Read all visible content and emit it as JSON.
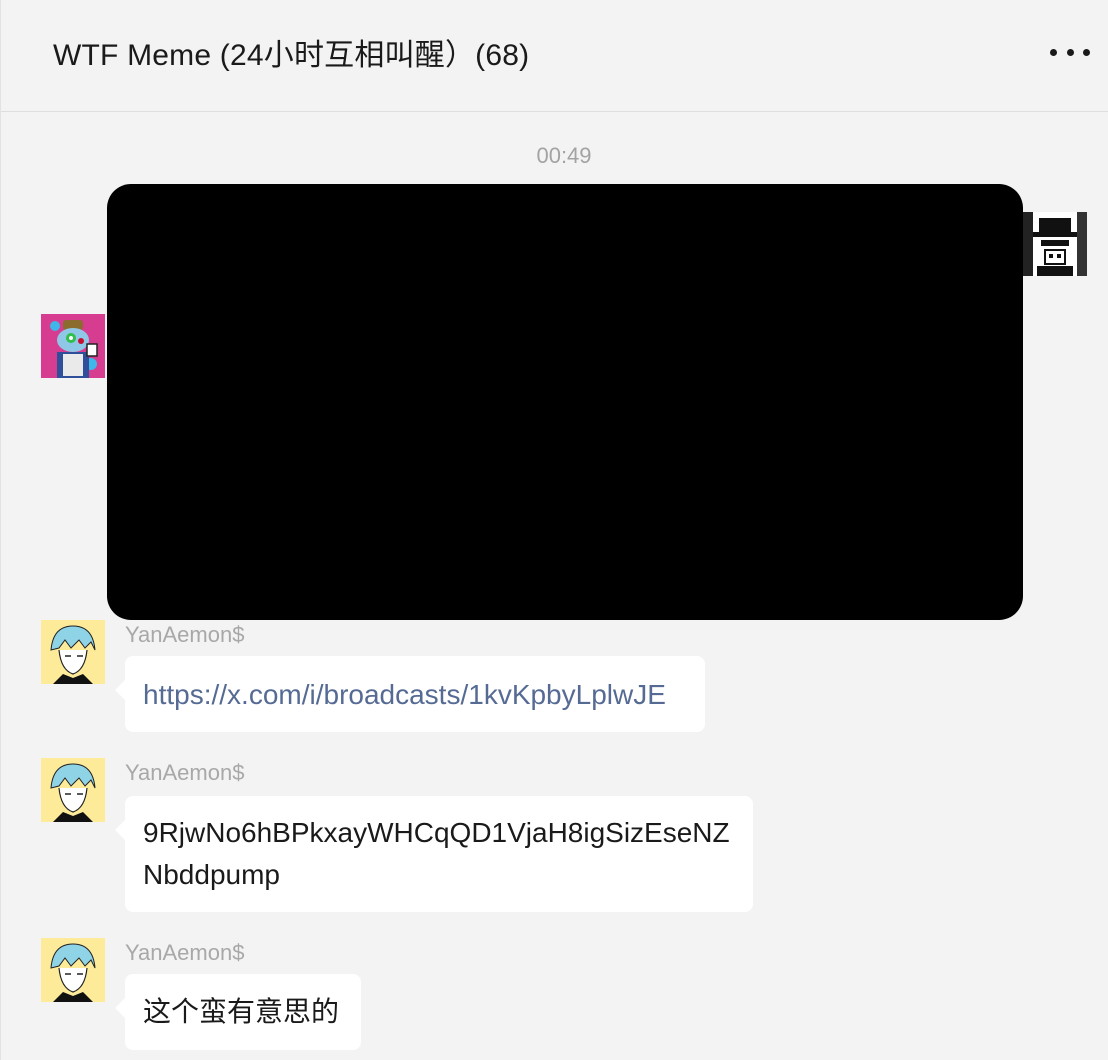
{
  "header": {
    "title": "WTF Meme (24小时互相叫醒）(68)",
    "more_icon": "more-horizontal-icon"
  },
  "chat": {
    "timestamp": "00:49",
    "messages": [
      {
        "sender": "YanAemon$",
        "text": "https://x.com/i/broadcasts/1kvKpbyLplwJE",
        "is_link": true
      },
      {
        "sender": "YanAemon$",
        "line1": "9RjwNo6hBPkxayWHCqQD1VjaH8igSizEseNZ",
        "line2": "Nbddpump"
      },
      {
        "sender": "YanAemon$",
        "text": "这个蛮有意思的"
      }
    ]
  },
  "colors": {
    "background": "#f3f3f3",
    "bubble": "#ffffff",
    "link": "#566b94",
    "timestamp": "#a3a3a3",
    "media_placeholder": "#000000"
  }
}
